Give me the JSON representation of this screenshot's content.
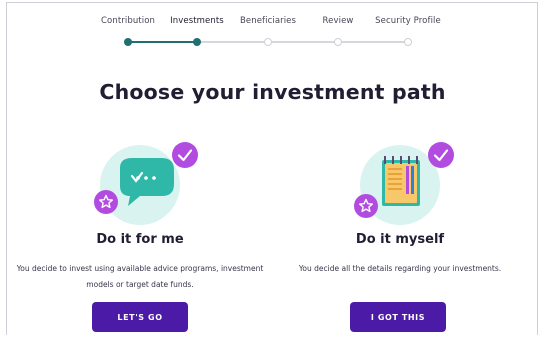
{
  "stepper": {
    "steps": [
      {
        "label": "Contribution",
        "state": "done"
      },
      {
        "label": "Investments",
        "state": "current"
      },
      {
        "label": "Beneficiaries",
        "state": "todo"
      },
      {
        "label": "Review",
        "state": "todo"
      },
      {
        "label": "Security Profile",
        "state": "todo"
      }
    ]
  },
  "title": "Choose your investment path",
  "options": [
    {
      "title": "Do it for me",
      "description": "You decide to invest using available advice programs, investment models or target date funds.",
      "button": "LET'S GO",
      "icon": "chat-bubble-icon"
    },
    {
      "title": "Do it myself",
      "description": "You decide all the details regarding your investments.",
      "button": "I GOT THIS",
      "icon": "notebook-icon"
    }
  ],
  "colors": {
    "accent": "#4b1aa6",
    "progress": "#1f6f73",
    "illustration_bg": "#d8f3f0",
    "badge": "#b24ce0",
    "bubble": "#2fb8a8"
  }
}
